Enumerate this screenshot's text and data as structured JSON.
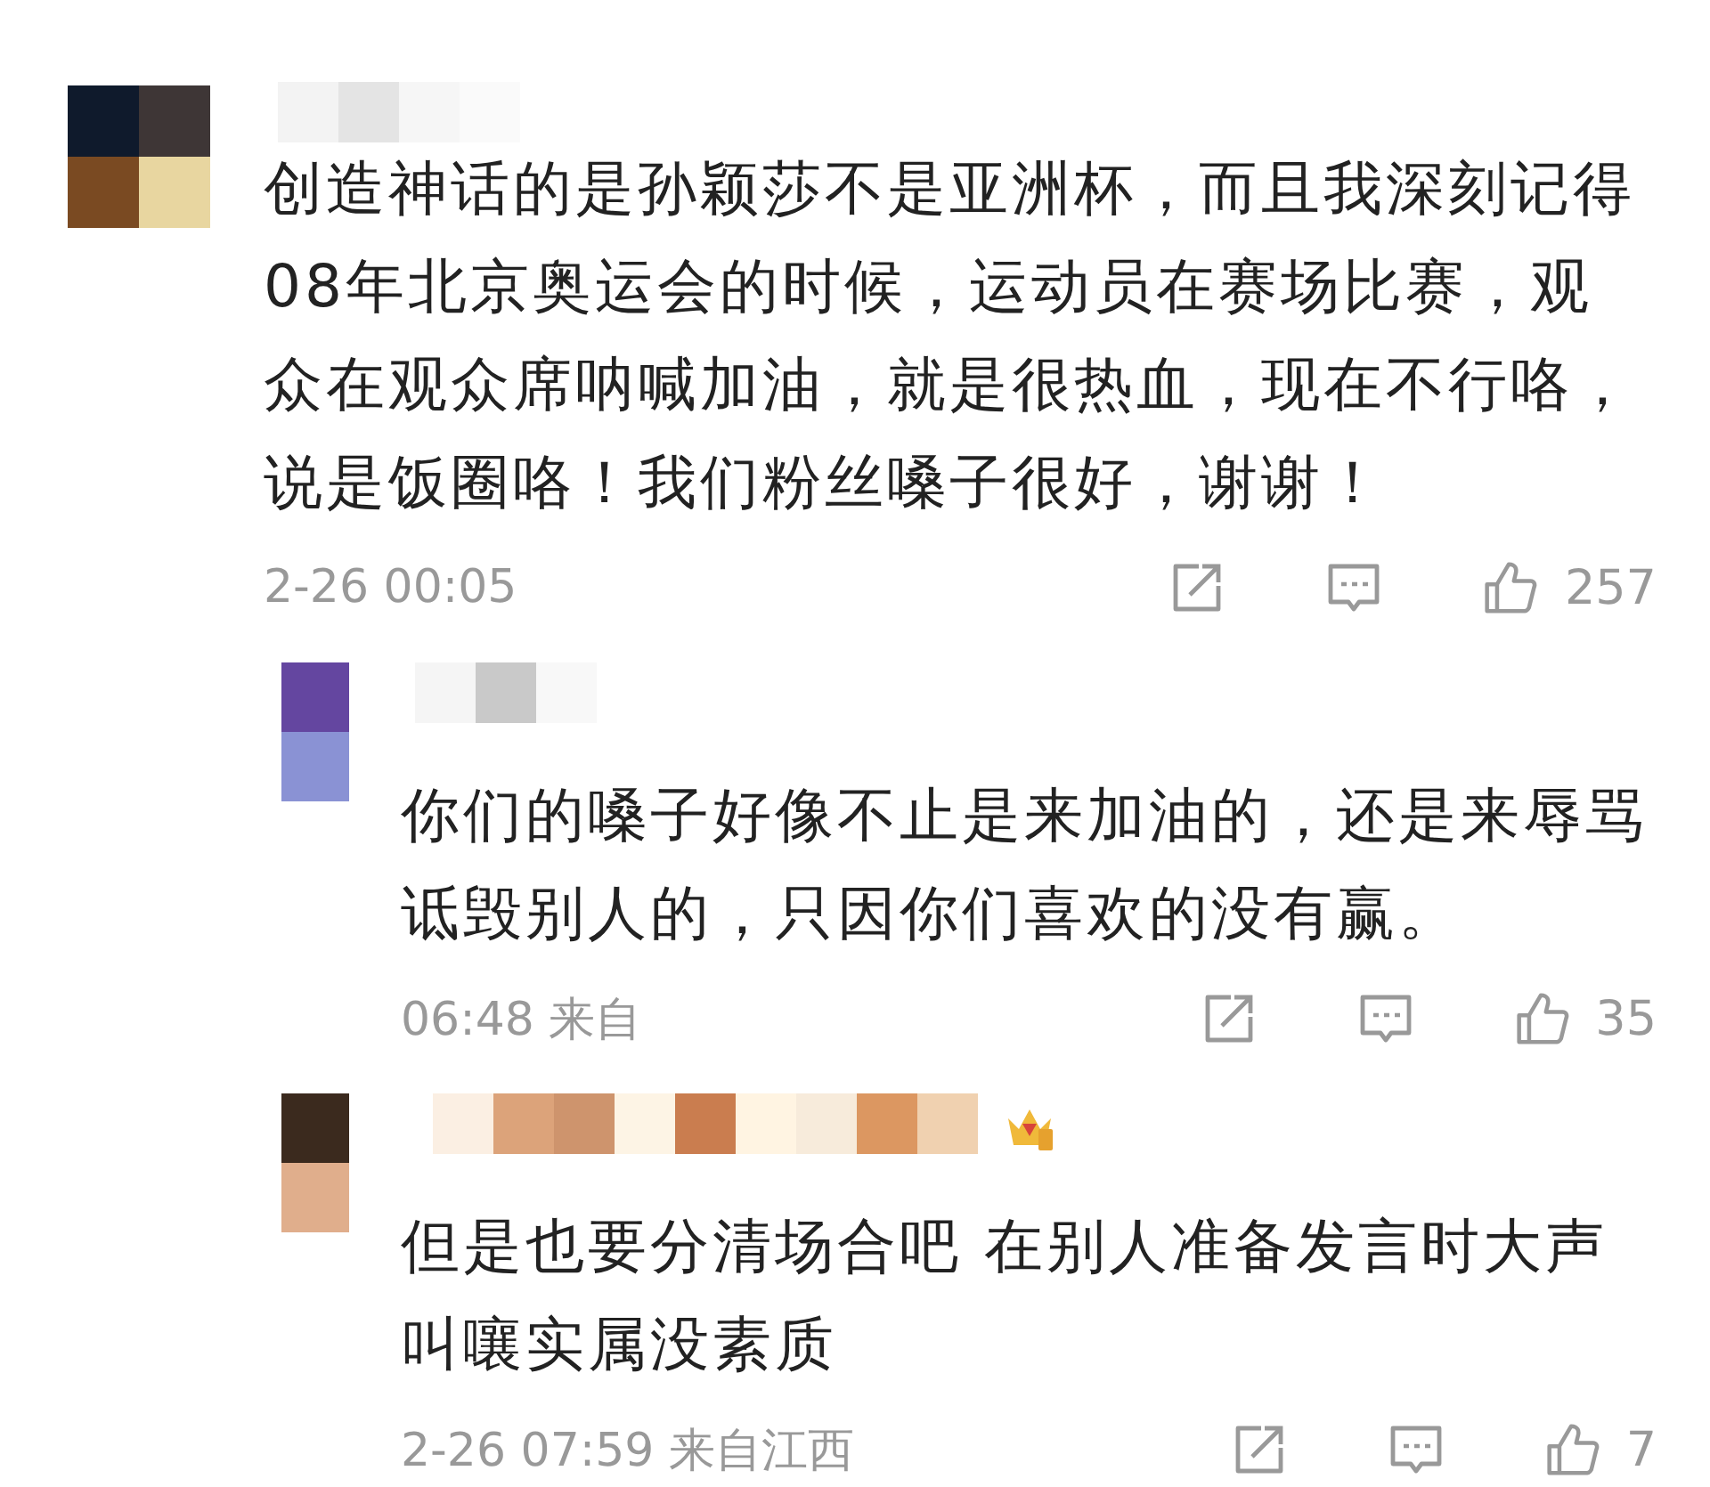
{
  "comments": [
    {
      "kind": "comment",
      "badge": false,
      "lines": [
        "创造神话的是孙颖莎不是亚洲杯，而且我深刻记得",
        "08年北京奥运会的时候，运动员在赛场比赛，观",
        "众在观众席呐喊加油，就是很热血，现在不行咯，",
        "说是饭圈咯！我们粉丝嗓子很好，谢谢！"
      ],
      "time": "2-26 00:05",
      "likes": "257"
    },
    {
      "kind": "reply",
      "badge": false,
      "lines": [
        "你们的嗓子好像不止是来加油的，还是来辱骂",
        "诋毁别人的，只因你们喜欢的没有赢。"
      ],
      "time": "06:48 来自",
      "likes": "35"
    },
    {
      "kind": "reply",
      "badge": true,
      "lines": [
        "但是也要分清场合吧 在别人准备发言时大声",
        "叫嚷实属没素质"
      ],
      "time": "2-26 07:59 来自江西",
      "likes": "7"
    }
  ]
}
